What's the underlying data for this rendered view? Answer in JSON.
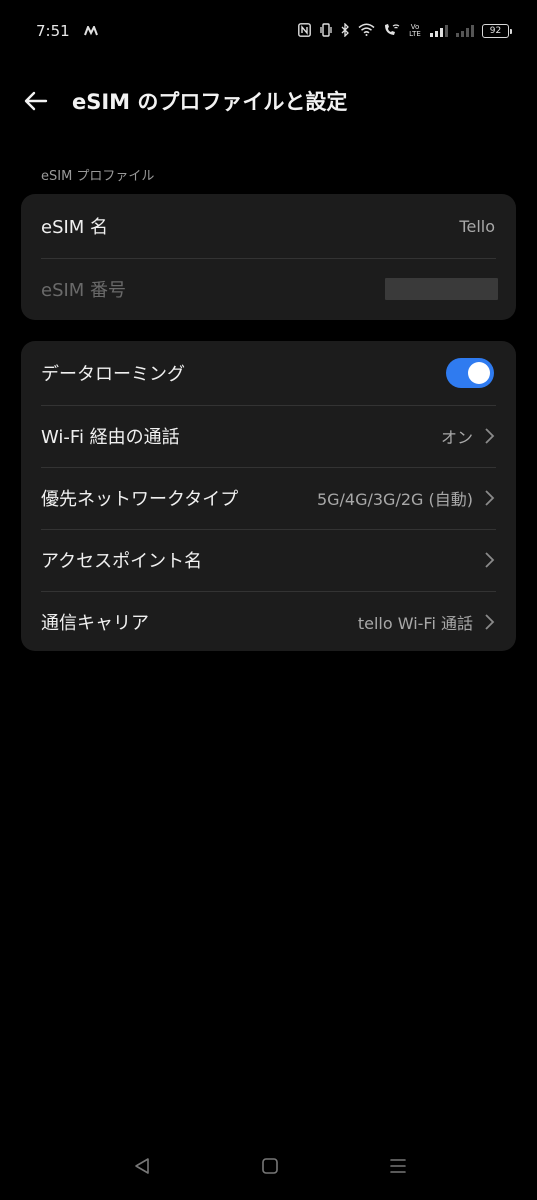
{
  "status_bar": {
    "time": "7:51",
    "notification_icon": "m-app-icon",
    "icons": [
      "nfc-icon",
      "vibrate-icon",
      "bluetooth-icon",
      "wifi-icon",
      "wifi-calling-icon",
      "volte-icon"
    ],
    "volte_text": "Vo LTE",
    "battery_level": "92"
  },
  "header": {
    "title": "eSIM のプロファイルと設定",
    "back_icon": "back-arrow-icon"
  },
  "profile_section": {
    "label": "eSIM プロファイル",
    "rows": [
      {
        "label": "eSIM 名",
        "value": "Tello"
      },
      {
        "label": "eSIM 番号",
        "value": ""
      }
    ]
  },
  "settings_section": {
    "rows": [
      {
        "label": "データローミング",
        "toggle": true
      },
      {
        "label": "Wi-Fi 経由の通話",
        "value": "オン"
      },
      {
        "label": "優先ネットワークタイプ",
        "value": "5G/4G/3G/2G (自動)"
      },
      {
        "label": "アクセスポイント名",
        "value": ""
      },
      {
        "label": "通信キャリア",
        "value": "tello Wi-Fi 通話"
      }
    ]
  },
  "nav_bar": {
    "buttons": [
      "nav-back-icon",
      "nav-home-icon",
      "nav-recents-icon"
    ]
  },
  "colors": {
    "background": "#000000",
    "card": "#1c1c1c",
    "accent": "#2f7bf0",
    "secondary_text": "#a8a8a8"
  }
}
